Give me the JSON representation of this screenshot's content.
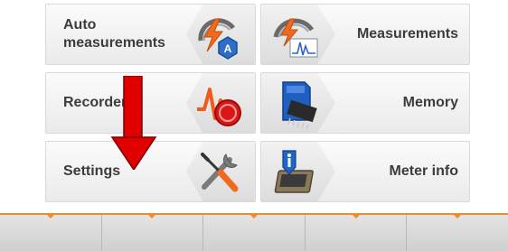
{
  "menu": {
    "auto_measurements": "Auto\nmeasurements",
    "measurements": "Measurements",
    "recorder": "Recorder",
    "memory": "Memory",
    "settings": "Settings",
    "meter_info": "Meter info"
  },
  "icons": {
    "auto_measurements": "auto-measurement-bolt-gauge-icon",
    "measurements": "measurement-gauge-waveform-icon",
    "recorder": "recorder-lightning-record-icon",
    "memory": "sd-card-memory-chip-icon",
    "settings": "wrench-screwdriver-icon",
    "meter_info": "info-meter-device-icon"
  },
  "bottom_bar": {
    "keys": [
      "",
      "",
      "",
      "",
      ""
    ],
    "accent_color": "#f08a2a"
  },
  "annotation": {
    "arrow_color": "#e00000"
  }
}
